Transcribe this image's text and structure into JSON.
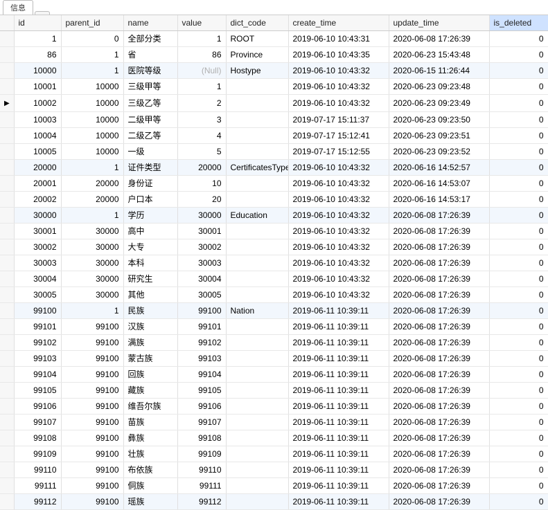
{
  "tabs": [
    {
      "label": "信息",
      "active": true
    },
    {
      "label": "",
      "active": false
    }
  ],
  "columns": [
    "id",
    "parent_id",
    "name",
    "value",
    "dict_code",
    "create_time",
    "update_time",
    "is_deleted"
  ],
  "null_text": "(Null)",
  "current_row_index": 5,
  "rows": [
    {
      "id": 1,
      "parent_id": 0,
      "name": "全部分类",
      "value": "1",
      "dict_code": "ROOT",
      "create_time": "2019-06-10 10:43:31",
      "update_time": "2020-06-08 17:26:39",
      "is_deleted": 0,
      "alt": false
    },
    {
      "id": 86,
      "parent_id": 1,
      "name": "省",
      "value": "86",
      "dict_code": "Province",
      "create_time": "2019-06-10 10:43:35",
      "update_time": "2020-06-23 15:43:48",
      "is_deleted": 0,
      "alt": false
    },
    {
      "id": 10000,
      "parent_id": 1,
      "name": "医院等级",
      "value": null,
      "dict_code": "Hostype",
      "create_time": "2019-06-10 10:43:32",
      "update_time": "2020-06-15 11:26:44",
      "is_deleted": 0,
      "alt": true
    },
    {
      "id": 10001,
      "parent_id": 10000,
      "name": "三级甲等",
      "value": "1",
      "dict_code": "",
      "create_time": "2019-06-10 10:43:32",
      "update_time": "2020-06-23 09:23:48",
      "is_deleted": 0,
      "alt": false
    },
    {
      "id": 10002,
      "parent_id": 10000,
      "name": "三级乙等",
      "value": "2",
      "dict_code": "",
      "create_time": "2019-06-10 10:43:32",
      "update_time": "2020-06-23 09:23:49",
      "is_deleted": 0,
      "alt": false
    },
    {
      "id": 10003,
      "parent_id": 10000,
      "name": "二级甲等",
      "value": "3",
      "dict_code": "",
      "create_time": "2019-07-17 15:11:37",
      "update_time": "2020-06-23 09:23:50",
      "is_deleted": 0,
      "alt": false
    },
    {
      "id": 10004,
      "parent_id": 10000,
      "name": "二级乙等",
      "value": "4",
      "dict_code": "",
      "create_time": "2019-07-17 15:12:41",
      "update_time": "2020-06-23 09:23:51",
      "is_deleted": 0,
      "alt": false
    },
    {
      "id": 10005,
      "parent_id": 10000,
      "name": "一级",
      "value": "5",
      "dict_code": "",
      "create_time": "2019-07-17 15:12:55",
      "update_time": "2020-06-23 09:23:52",
      "is_deleted": 0,
      "alt": false
    },
    {
      "id": 20000,
      "parent_id": 1,
      "name": "证件类型",
      "value": "20000",
      "dict_code": "CertificatesType",
      "create_time": "2019-06-10 10:43:32",
      "update_time": "2020-06-16 14:52:57",
      "is_deleted": 0,
      "alt": true
    },
    {
      "id": 20001,
      "parent_id": 20000,
      "name": "身份证",
      "value": "10",
      "dict_code": "",
      "create_time": "2019-06-10 10:43:32",
      "update_time": "2020-06-16 14:53:07",
      "is_deleted": 0,
      "alt": false
    },
    {
      "id": 20002,
      "parent_id": 20000,
      "name": "户口本",
      "value": "20",
      "dict_code": "",
      "create_time": "2019-06-10 10:43:32",
      "update_time": "2020-06-16 14:53:17",
      "is_deleted": 0,
      "alt": false
    },
    {
      "id": 30000,
      "parent_id": 1,
      "name": "学历",
      "value": "30000",
      "dict_code": "Education",
      "create_time": "2019-06-10 10:43:32",
      "update_time": "2020-06-08 17:26:39",
      "is_deleted": 0,
      "alt": true
    },
    {
      "id": 30001,
      "parent_id": 30000,
      "name": "高中",
      "value": "30001",
      "dict_code": "",
      "create_time": "2019-06-10 10:43:32",
      "update_time": "2020-06-08 17:26:39",
      "is_deleted": 0,
      "alt": false
    },
    {
      "id": 30002,
      "parent_id": 30000,
      "name": "大专",
      "value": "30002",
      "dict_code": "",
      "create_time": "2019-06-10 10:43:32",
      "update_time": "2020-06-08 17:26:39",
      "is_deleted": 0,
      "alt": false
    },
    {
      "id": 30003,
      "parent_id": 30000,
      "name": "本科",
      "value": "30003",
      "dict_code": "",
      "create_time": "2019-06-10 10:43:32",
      "update_time": "2020-06-08 17:26:39",
      "is_deleted": 0,
      "alt": false
    },
    {
      "id": 30004,
      "parent_id": 30000,
      "name": "研究生",
      "value": "30004",
      "dict_code": "",
      "create_time": "2019-06-10 10:43:32",
      "update_time": "2020-06-08 17:26:39",
      "is_deleted": 0,
      "alt": false
    },
    {
      "id": 30005,
      "parent_id": 30000,
      "name": "其他",
      "value": "30005",
      "dict_code": "",
      "create_time": "2019-06-10 10:43:32",
      "update_time": "2020-06-08 17:26:39",
      "is_deleted": 0,
      "alt": false
    },
    {
      "id": 99100,
      "parent_id": 1,
      "name": "民族",
      "value": "99100",
      "dict_code": "Nation",
      "create_time": "2019-06-11 10:39:11",
      "update_time": "2020-06-08 17:26:39",
      "is_deleted": 0,
      "alt": true
    },
    {
      "id": 99101,
      "parent_id": 99100,
      "name": "汉族",
      "value": "99101",
      "dict_code": "",
      "create_time": "2019-06-11 10:39:11",
      "update_time": "2020-06-08 17:26:39",
      "is_deleted": 0,
      "alt": false
    },
    {
      "id": 99102,
      "parent_id": 99100,
      "name": "满族",
      "value": "99102",
      "dict_code": "",
      "create_time": "2019-06-11 10:39:11",
      "update_time": "2020-06-08 17:26:39",
      "is_deleted": 0,
      "alt": false
    },
    {
      "id": 99103,
      "parent_id": 99100,
      "name": "蒙古族",
      "value": "99103",
      "dict_code": "",
      "create_time": "2019-06-11 10:39:11",
      "update_time": "2020-06-08 17:26:39",
      "is_deleted": 0,
      "alt": false
    },
    {
      "id": 99104,
      "parent_id": 99100,
      "name": "回族",
      "value": "99104",
      "dict_code": "",
      "create_time": "2019-06-11 10:39:11",
      "update_time": "2020-06-08 17:26:39",
      "is_deleted": 0,
      "alt": false
    },
    {
      "id": 99105,
      "parent_id": 99100,
      "name": "藏族",
      "value": "99105",
      "dict_code": "",
      "create_time": "2019-06-11 10:39:11",
      "update_time": "2020-06-08 17:26:39",
      "is_deleted": 0,
      "alt": false
    },
    {
      "id": 99106,
      "parent_id": 99100,
      "name": "维吾尔族",
      "value": "99106",
      "dict_code": "",
      "create_time": "2019-06-11 10:39:11",
      "update_time": "2020-06-08 17:26:39",
      "is_deleted": 0,
      "alt": false
    },
    {
      "id": 99107,
      "parent_id": 99100,
      "name": "苗族",
      "value": "99107",
      "dict_code": "",
      "create_time": "2019-06-11 10:39:11",
      "update_time": "2020-06-08 17:26:39",
      "is_deleted": 0,
      "alt": false
    },
    {
      "id": 99108,
      "parent_id": 99100,
      "name": "彝族",
      "value": "99108",
      "dict_code": "",
      "create_time": "2019-06-11 10:39:11",
      "update_time": "2020-06-08 17:26:39",
      "is_deleted": 0,
      "alt": false
    },
    {
      "id": 99109,
      "parent_id": 99100,
      "name": "壮族",
      "value": "99109",
      "dict_code": "",
      "create_time": "2019-06-11 10:39:11",
      "update_time": "2020-06-08 17:26:39",
      "is_deleted": 0,
      "alt": false
    },
    {
      "id": 99110,
      "parent_id": 99100,
      "name": "布依族",
      "value": "99110",
      "dict_code": "",
      "create_time": "2019-06-11 10:39:11",
      "update_time": "2020-06-08 17:26:39",
      "is_deleted": 0,
      "alt": false
    },
    {
      "id": 99111,
      "parent_id": 99100,
      "name": "侗族",
      "value": "99111",
      "dict_code": "",
      "create_time": "2019-06-11 10:39:11",
      "update_time": "2020-06-08 17:26:39",
      "is_deleted": 0,
      "alt": false
    },
    {
      "id": 99112,
      "parent_id": 99100,
      "name": "瑶族",
      "value": "99112",
      "dict_code": "",
      "create_time": "2019-06-11 10:39:11",
      "update_time": "2020-06-08 17:26:39",
      "is_deleted": 0,
      "alt": true
    }
  ]
}
